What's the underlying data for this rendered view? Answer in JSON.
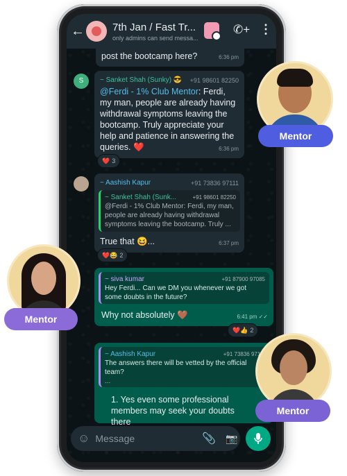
{
  "header": {
    "title": "7th Jan / Fast Tr...",
    "subtitle": "only admins can send messa..."
  },
  "messages": {
    "m0": {
      "text": "post the bootcamp here?",
      "time": "6:36 pm"
    },
    "m1": {
      "sender": "~ Sanket Shah (Sunky) 😎",
      "phone": "+91 98601 82250",
      "mention": "@Ferdi - 1% Club Mentor",
      "text": ": Ferdi, my man, people are already having withdrawal symptoms leaving the bootcamp. Truly appreciate your help and patience in answering the queries. ❤️",
      "time": "6:36 pm",
      "reaction": "❤️",
      "reaction_count": "3"
    },
    "m2": {
      "sender": "~ Aashish Kapur",
      "phone": "+91 73836 97111",
      "quote_sender": "~ Sanket Shah (Sunk...",
      "quote_phone": "+91 98601 82250",
      "quote_text": "@Ferdi - 1% Club Mentor: Ferdi, my man, people are already having withdrawal symptoms leaving the bootcamp. Truly ...",
      "text": "True that 😆...",
      "time": "6:37 pm",
      "reaction": "❤️😂",
      "reaction_count": "2"
    },
    "m3": {
      "quote_sender": "~ siva kumar",
      "quote_phone": "+91 87900 97085",
      "quote_text": "Hey Ferdi... Can we DM you whenever we got some doubts in the future?",
      "text": "Why not absolutely 🤎",
      "time": "6:41 pm ✓✓",
      "reaction": "❤️👍",
      "reaction_count": "2"
    },
    "m4": {
      "quote_sender": "~ Aashish Kapur",
      "quote_phone": "+91 73836 971...",
      "quote_text": "The answers there will be vetted by the official team?",
      "quote_more": "...",
      "text": "1. Yes even some professional members may seek your doubts there"
    }
  },
  "input": {
    "placeholder": "Message"
  },
  "badges": {
    "right_top": "Mentor",
    "left_mid": "Mentor",
    "right_bottom": "Mentor"
  },
  "colors": {
    "badge": "#6b5bd6",
    "incoming_bubble": "#1f2c33",
    "outgoing_bubble": "#005c4b",
    "accent": "#00a884"
  }
}
